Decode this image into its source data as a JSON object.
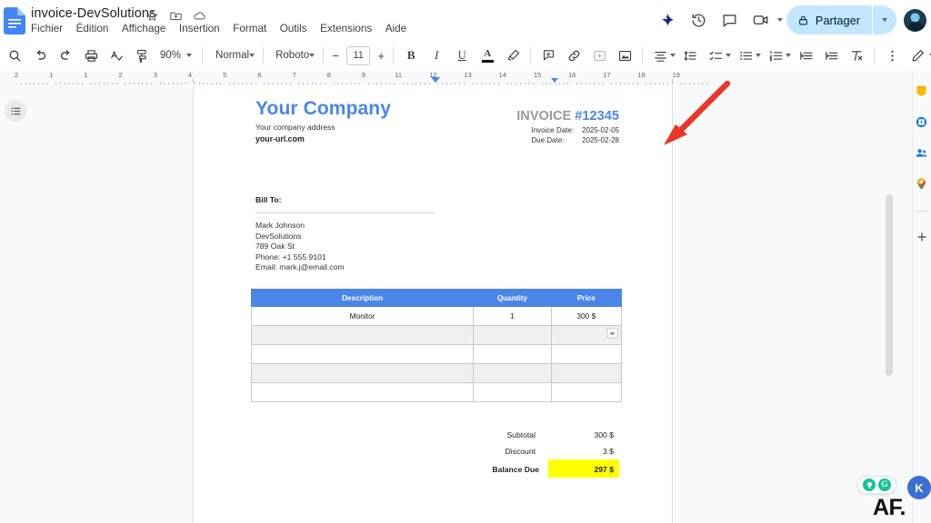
{
  "window": {
    "doc_title": "invoice-DevSolutions",
    "title_icons": [
      "star-icon",
      "move-to-folder-icon",
      "cloud-saved-icon"
    ],
    "menu": [
      "Fichier",
      "Édition",
      "Affichage",
      "Insertion",
      "Format",
      "Outils",
      "Extensions",
      "Aide"
    ],
    "share_label": "Partager",
    "right_icons": [
      "gemini-icon",
      "version-history-icon",
      "comment-icon",
      "meet-icon"
    ]
  },
  "toolbar": {
    "zoom": "90%",
    "paragraph_style": "Normal",
    "font": "Roboto",
    "font_size": "11",
    "decrease_label": "−",
    "increase_label": "+",
    "bold_label": "B",
    "italic_label": "I",
    "underline_label": "U",
    "text_color_label": "A",
    "items": [
      "search-icon",
      "undo-icon",
      "redo-icon",
      "print-icon",
      "spelling-check-icon",
      "paint-format-icon",
      "bold-icon",
      "italic-icon",
      "underline-icon",
      "text-color-icon",
      "highlight-color-icon",
      "insert-comment-icon",
      "insert-link-icon",
      "insert-image-icon",
      "insert-drawing-icon",
      "align-icon",
      "line-spacing-icon",
      "checklist-icon",
      "bulleted-list-icon",
      "numbered-list-icon",
      "decrease-indent-icon",
      "increase-indent-icon",
      "clear-formatting-icon",
      "more-options-icon",
      "editing-mode-icon",
      "collapse-toolbar-icon"
    ]
  },
  "ruler": {
    "numbers": [
      "2",
      "1",
      "1",
      "2",
      "3",
      "4",
      "5",
      "6",
      "7",
      "8",
      "9",
      "11",
      "12",
      "13",
      "14",
      "15",
      "16",
      "17",
      "18",
      "19"
    ]
  },
  "document": {
    "company_name": "Your Company",
    "company_address": "Your company address",
    "company_url": "your-url.com",
    "invoice_word": "INVOICE ",
    "invoice_number": "#12345",
    "dates": [
      {
        "label": "Invoice Date:",
        "value": "2025-02-05"
      },
      {
        "label": "Due Date:",
        "value": "2025-02-28"
      }
    ],
    "bill_to_label": "Bill To:",
    "bill_to": [
      "Mark Johnson",
      "DevSolutions",
      "789 Oak St",
      "Phone: +1 555 9101",
      "Email: mark.j@email.com"
    ],
    "table": {
      "headers": [
        "Description",
        "Quantity",
        "Price"
      ],
      "rows": [
        [
          "Monitor",
          "1",
          "300 $"
        ],
        [
          "",
          "",
          ""
        ],
        [
          "",
          "",
          ""
        ],
        [
          "",
          "",
          ""
        ],
        [
          "",
          "",
          ""
        ]
      ]
    },
    "totals": [
      {
        "label": "Subtotal",
        "value": "300 $"
      },
      {
        "label": "Discount",
        "value": "3 $"
      },
      {
        "label": "Balance Due",
        "value": "297 $"
      }
    ]
  },
  "side_panel": {
    "items": [
      "keep-icon",
      "calendar-icon",
      "contacts-icon",
      "maps-icon",
      "add-apps-icon"
    ]
  },
  "overlay": {
    "watermark": "AF.",
    "grammarly_letter": "G"
  },
  "colors": {
    "accent_blue": "#4a86e8",
    "share_blue": "#c2e7ff",
    "highlight_yellow": "#ffff00",
    "arrow_red": "#e8382b",
    "invoice_gray": "#999999"
  }
}
